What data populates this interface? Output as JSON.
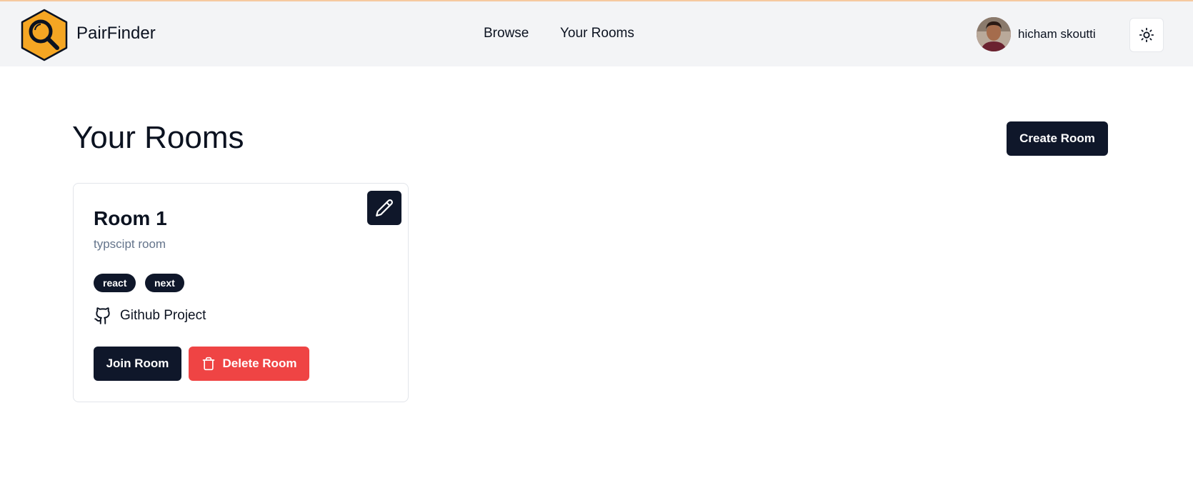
{
  "app": {
    "brand": "PairFinder",
    "logo_icon": "magnifier-hexagon-icon",
    "brand_color": "#f5a623"
  },
  "nav": {
    "browse": "Browse",
    "your_rooms": "Your Rooms"
  },
  "user": {
    "name": "hicham skoutti",
    "avatar": "avatar-photo"
  },
  "theme_toggle": {
    "icon": "sun-icon"
  },
  "page": {
    "title": "Your Rooms",
    "create_button": "Create Room"
  },
  "rooms": [
    {
      "name": "Room 1",
      "description": "typscipt room",
      "tags": [
        "react",
        "next"
      ],
      "github_label": "Github Project",
      "github_icon": "github-icon",
      "edit_icon": "pencil-icon",
      "join_button": "Join Room",
      "delete_button": "Delete Room",
      "delete_icon": "trash-icon"
    }
  ],
  "colors": {
    "primary": "#0f172a",
    "danger": "#ef4444",
    "muted_text": "#64748b",
    "header_bg": "#f3f4f6"
  }
}
